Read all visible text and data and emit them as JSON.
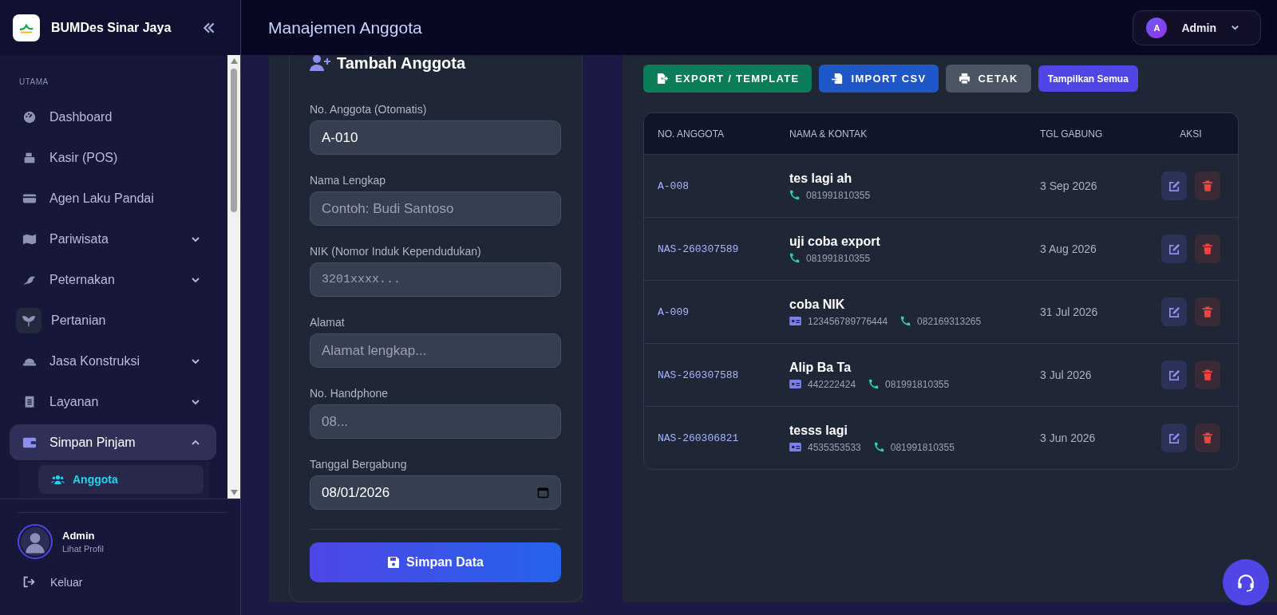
{
  "sidebar": {
    "brand": "BUMDes Sinar Jaya",
    "section_label": "UTAMA",
    "items": [
      {
        "label": "Dashboard",
        "kind": "link",
        "selected": false,
        "hovered": false
      },
      {
        "label": "Kasir (POS)",
        "kind": "link",
        "selected": false,
        "hovered": false
      },
      {
        "label": "Agen Laku Pandai",
        "kind": "link",
        "selected": false,
        "hovered": false
      },
      {
        "label": "Pariwisata",
        "kind": "group",
        "selected": false,
        "hovered": false,
        "expanded": false
      },
      {
        "label": "Peternakan",
        "kind": "group",
        "selected": false,
        "hovered": false,
        "expanded": false
      },
      {
        "label": "Pertanian",
        "kind": "link",
        "selected": false,
        "hovered": true
      },
      {
        "label": "Jasa Konstruksi",
        "kind": "group",
        "selected": false,
        "hovered": false,
        "expanded": false
      },
      {
        "label": "Layanan",
        "kind": "group",
        "selected": false,
        "hovered": false,
        "expanded": false
      },
      {
        "label": "Simpan Pinjam",
        "kind": "group",
        "selected": true,
        "hovered": false,
        "expanded": true,
        "children": [
          {
            "label": "Anggota",
            "selected": true
          }
        ]
      }
    ],
    "user": {
      "name": "Admin",
      "link": "Lihat Profil"
    },
    "logout": "Keluar"
  },
  "header": {
    "title": "Manajemen Anggota",
    "user_menu": {
      "initial": "A",
      "name": "Admin"
    }
  },
  "form": {
    "title": "Tambah Anggota",
    "fields": [
      {
        "label": "No. Anggota (Otomatis)",
        "kind": "text",
        "value": "A-010"
      },
      {
        "label": "Nama Lengkap",
        "kind": "text",
        "placeholder": "Contoh: Budi Santoso"
      },
      {
        "label": "NIK (Nomor Induk Kependudukan)",
        "kind": "mono",
        "placeholder": "3201xxxx..."
      },
      {
        "label": "Alamat",
        "kind": "text",
        "placeholder": "Alamat lengkap..."
      },
      {
        "label": "No. Handphone",
        "kind": "text",
        "placeholder": "08..."
      },
      {
        "label": "Tanggal Bergabung",
        "kind": "date",
        "value": "08/01/2026"
      }
    ],
    "submit": "Simpan Data"
  },
  "toolbar": [
    {
      "label": "EXPORT / TEMPLATE",
      "kind": "export"
    },
    {
      "label": "IMPORT CSV",
      "kind": "import"
    },
    {
      "label": "CETAK",
      "kind": "print"
    },
    {
      "label": "Tampilkan Semua",
      "kind": "filter"
    }
  ],
  "table": {
    "columns": [
      "NO. ANGGOTA",
      "NAMA & KONTAK",
      "TGL GABUNG",
      "AKSI"
    ],
    "rows": [
      {
        "id": "A-008",
        "name": "tes lagi ah",
        "phone": "081991810355",
        "joined": "3 Sep 2026"
      },
      {
        "id": "NAS-260307589",
        "name": "uji coba export",
        "phone": "081991810355",
        "joined": "3 Aug 2026"
      },
      {
        "id": "A-009",
        "name": "coba NIK",
        "nik": "123456789776444",
        "phone": "082169313265",
        "joined": "31 Jul 2026"
      },
      {
        "id": "NAS-260307588",
        "name": "Alip Ba Ta",
        "nik": "442222424",
        "phone": "081991810355",
        "joined": "3 Jul 2026"
      },
      {
        "id": "NAS-260306821",
        "name": "tesss lagi",
        "nik": "4535353533",
        "phone": "081991810355",
        "joined": "3 Jun 2026"
      }
    ]
  }
}
